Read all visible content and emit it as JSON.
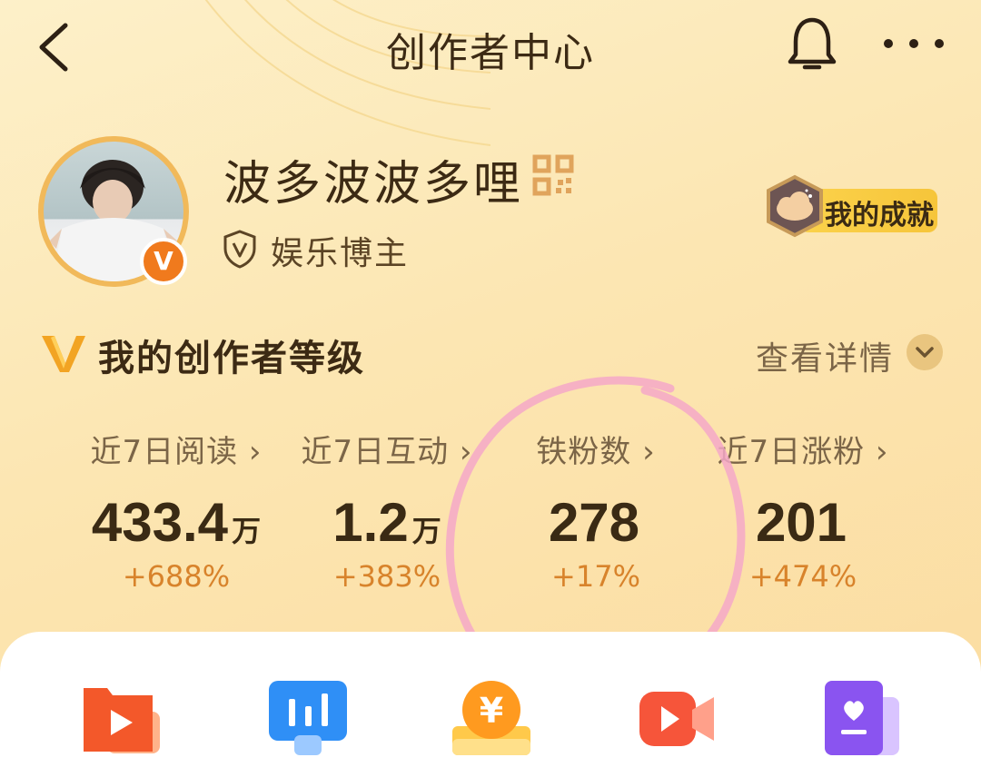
{
  "header": {
    "title": "创作者中心"
  },
  "profile": {
    "username": "波多波波多哩",
    "role": "娱乐博主",
    "verified_badge": "V",
    "achievement_label": "我的成就"
  },
  "level": {
    "title": "我的创作者等级",
    "detail_label": "查看详情"
  },
  "stats": [
    {
      "label": "近7日阅读",
      "value": "433.4",
      "unit": "万",
      "change": "+688%"
    },
    {
      "label": "近7日互动",
      "value": "1.2",
      "unit": "万",
      "change": "+383%"
    },
    {
      "label": "铁粉数",
      "value": "278",
      "unit": "",
      "change": "+17%"
    },
    {
      "label": "近7日涨粉",
      "value": "201",
      "unit": "",
      "change": "+474%"
    }
  ],
  "colors": {
    "accent": "#f07a1d",
    "change": "#d8832b",
    "text": "#3c2a14",
    "annotation": "#f5a8c8"
  },
  "icons": [
    "back-icon",
    "bell-icon",
    "more-icon",
    "qr-code-icon",
    "shield-icon",
    "achievement-icon",
    "level-v-icon",
    "chevron-down-icon",
    "video-folder-icon",
    "analytics-icon",
    "income-icon",
    "live-video-icon",
    "favorites-book-icon"
  ]
}
